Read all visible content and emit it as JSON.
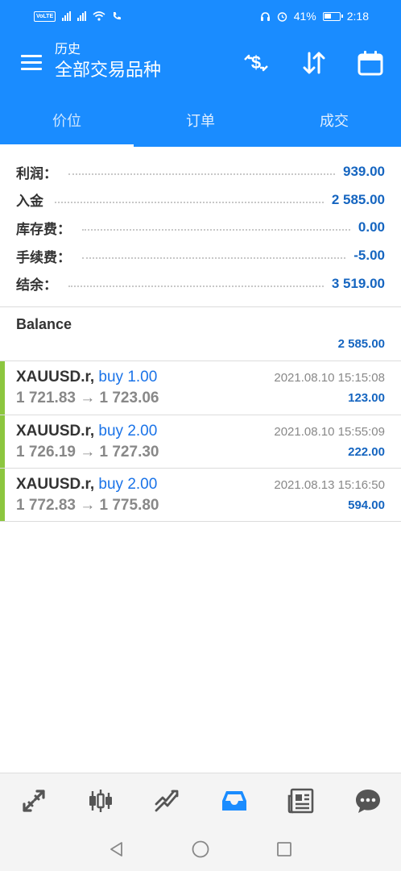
{
  "status_bar": {
    "volte": "VoLTE",
    "battery_percent": "41%",
    "time": "2:18"
  },
  "app_bar": {
    "subtitle": "历史",
    "title": "全部交易品种"
  },
  "tabs": [
    {
      "label": "价位",
      "active": true
    },
    {
      "label": "订单",
      "active": false
    },
    {
      "label": "成交",
      "active": false
    }
  ],
  "summary": [
    {
      "label": "利润：",
      "value": "939.00"
    },
    {
      "label": "入金",
      "value": "2 585.00"
    },
    {
      "label": "库存费：",
      "value": "0.00"
    },
    {
      "label": "手续费：",
      "value": "-5.00"
    },
    {
      "label": "结余：",
      "value": "3 519.00"
    }
  ],
  "balance": {
    "label": "Balance",
    "value": "2 585.00"
  },
  "deals": [
    {
      "symbol": "XAUUSD.r,",
      "side": "buy 1.00",
      "prices": "1 721.83 → 1 723.06",
      "time": "2021.08.10 15:15:08",
      "profit": "123.00"
    },
    {
      "symbol": "XAUUSD.r,",
      "side": "buy 2.00",
      "prices": "1 726.19 → 1 727.30",
      "time": "2021.08.10 15:55:09",
      "profit": "222.00"
    },
    {
      "symbol": "XAUUSD.r,",
      "side": "buy 2.00",
      "prices": "1 772.83 → 1 775.80",
      "time": "2021.08.13 15:16:50",
      "profit": "594.00"
    }
  ],
  "bottom_nav": [
    {
      "icon": "quotes-arrows-icon",
      "active": false
    },
    {
      "icon": "candlestick-chart-icon",
      "active": false
    },
    {
      "icon": "trade-trend-icon",
      "active": false
    },
    {
      "icon": "history-inbox-icon",
      "active": true
    },
    {
      "icon": "news-icon",
      "active": false
    },
    {
      "icon": "chat-icon",
      "active": false
    }
  ],
  "colors": {
    "primary": "#1a8cff",
    "value_blue": "#1565c0",
    "buy_blue": "#1a73e8",
    "deal_bar_green": "#8cc63f",
    "nav_active": "#1a8cff",
    "nav_inactive": "#555555"
  }
}
